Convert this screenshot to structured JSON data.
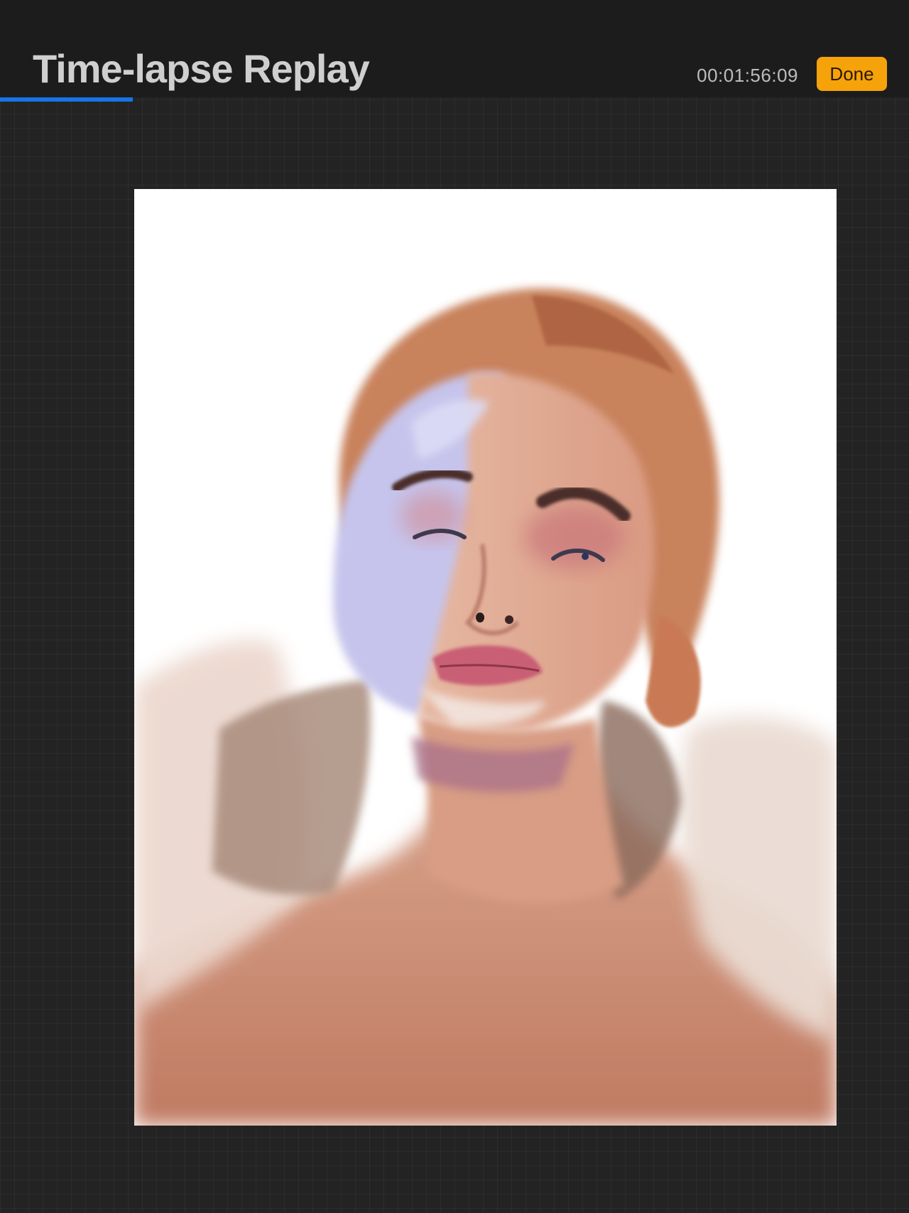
{
  "header": {
    "title": "Time-lapse Replay",
    "timecode": "00:01:56:09",
    "done_label": "Done"
  },
  "playback": {
    "progress_fraction": 0.146
  },
  "colors": {
    "accent_blue": "#1674e6",
    "done_orange": "#f6a20b",
    "background": "#232323",
    "topbar": "#1c1c1c"
  },
  "artwork": {
    "subject": "painted-portrait"
  }
}
